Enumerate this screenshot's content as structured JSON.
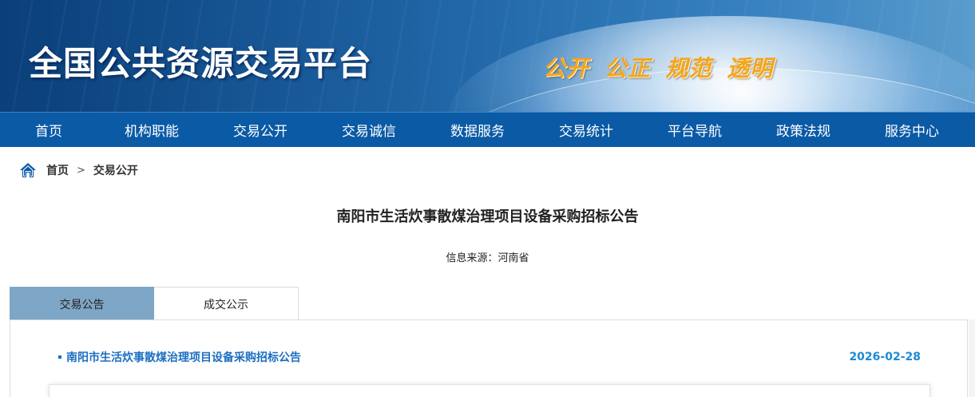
{
  "header": {
    "site_title": "全国公共资源交易平台",
    "slogan": "公开 公正 规范 透明"
  },
  "nav": {
    "items": [
      "首页",
      "机构职能",
      "交易公开",
      "交易诚信",
      "数据服务",
      "交易统计",
      "平台导航",
      "政策法规",
      "服务中心"
    ]
  },
  "breadcrumb": {
    "home": "首页",
    "separator": ">",
    "current": "交易公开"
  },
  "article": {
    "title": "南阳市生活炊事散煤治理项目设备采购招标公告",
    "source": "信息来源：河南省"
  },
  "tabs": [
    {
      "label": "交易公告",
      "active": true
    },
    {
      "label": "成交公示",
      "active": false
    }
  ],
  "list": [
    {
      "title": "南阳市生活炊事散煤治理项目设备采购招标公告",
      "date": "2026-02-28"
    }
  ],
  "colors": {
    "nav_bg": "#0a5aa6",
    "active_tab": "#7ea6c6",
    "link": "#1c6fc0",
    "slogan": "#f4a61d"
  }
}
